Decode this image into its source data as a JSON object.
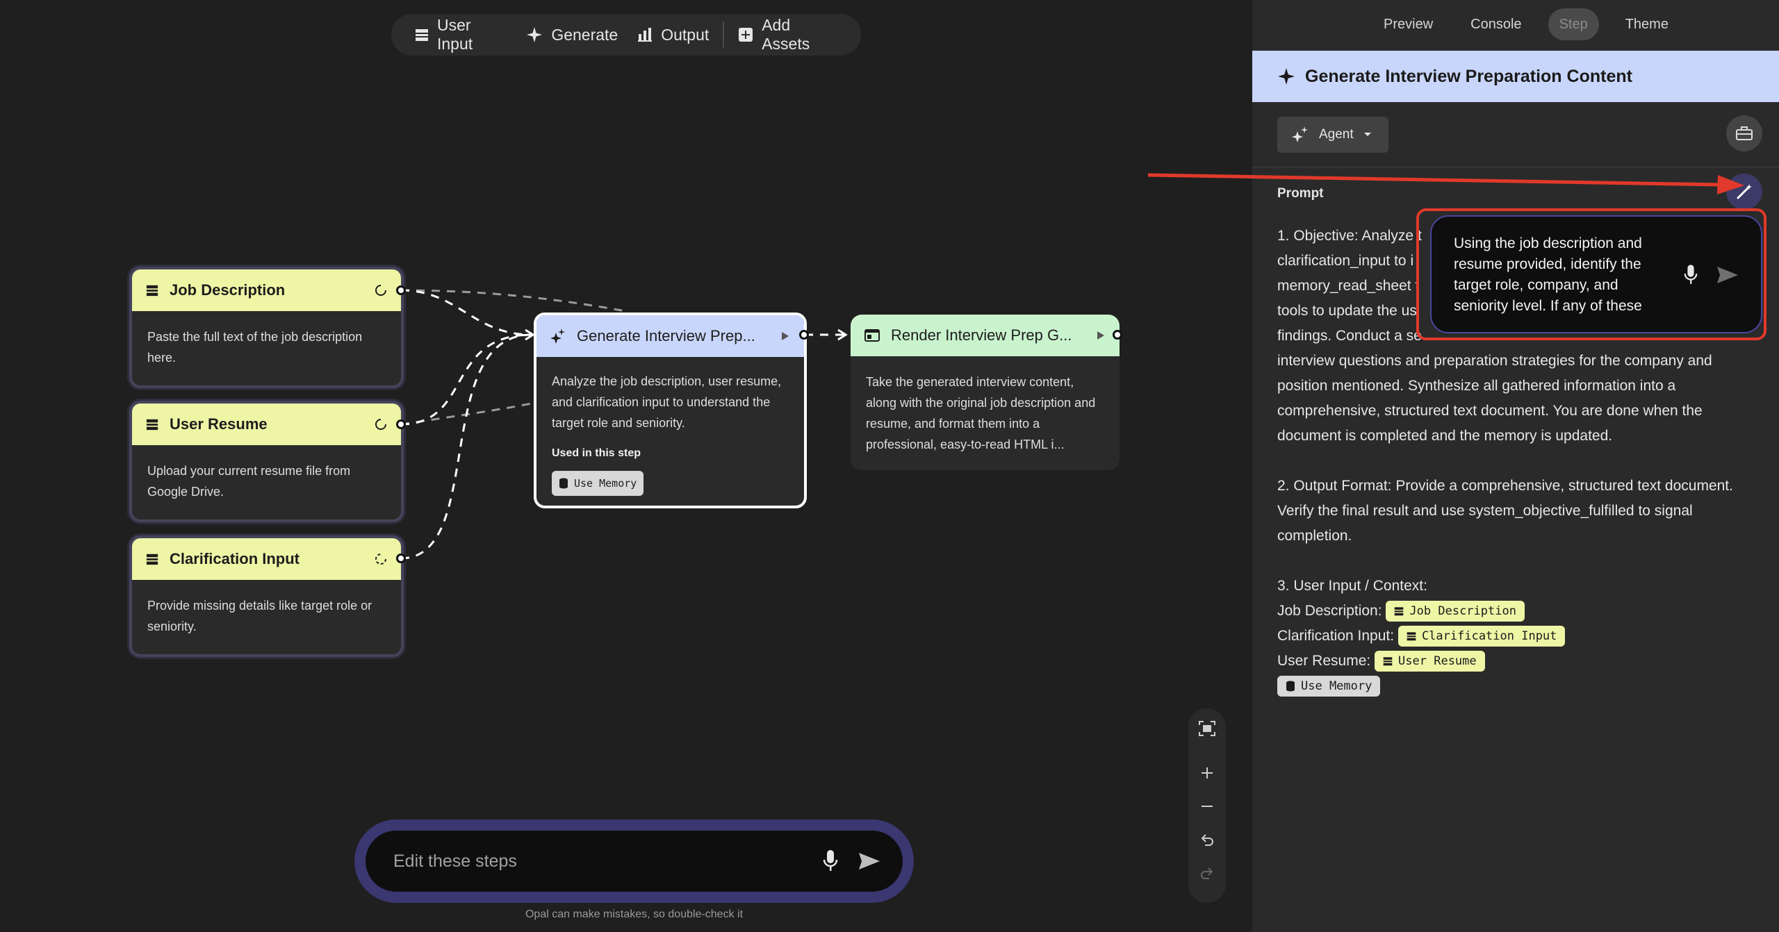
{
  "toolbar": {
    "user_input": "User Input",
    "generate": "Generate",
    "output": "Output",
    "add_assets": "Add Assets"
  },
  "nodes": {
    "job_description": {
      "title": "Job Description",
      "body": "Paste the full text of the job description here."
    },
    "user_resume": {
      "title": "User Resume",
      "body": "Upload your current resume file from Google Drive."
    },
    "clarification_input": {
      "title": "Clarification Input",
      "body": "Provide missing details like target role or seniority."
    },
    "generate": {
      "title": "Generate Interview Prep...",
      "body": "Analyze the job description, user resume, and clarification input to understand the target role and seniority.",
      "used_label": "Used in this step",
      "chip": "Use Memory"
    },
    "render": {
      "title": "Render Interview Prep G...",
      "body": "Take the generated interview content, along with the original job description and resume, and format them into a professional, easy-to-read HTML i..."
    }
  },
  "edit_bar": {
    "placeholder": "Edit these steps",
    "disclaimer": "Opal can make mistakes, so double-check it"
  },
  "panel": {
    "tabs": [
      "Preview",
      "Console",
      "Step",
      "Theme"
    ],
    "active_tab": "Step",
    "step_title": "Generate Interview Preparation Content",
    "agent_label": "Agent",
    "prompt_label": "Prompt",
    "prompt": {
      "p1_lines": [
        "1. Objective: Analyze t",
        "clarification_input to i",
        "memory_read_sheet t",
        "tools to update the us",
        "findings. Conduct a se",
        "interview questions and preparation strategies for the company and",
        "position mentioned. Synthesize all gathered information into a",
        "comprehensive, structured text document. You are done when the",
        "document is completed and the memory is updated."
      ],
      "p2": "2. Output Format: Provide a comprehensive, structured text document. Verify the final result and use system_objective_fulfilled to signal completion.",
      "p3_heading": "3. User Input / Context:",
      "job_description_label": "Job Description:",
      "job_description_chip": "Job Description",
      "clarification_label": "Clarification Input:",
      "clarification_chip": "Clarification Input",
      "resume_label": "User Resume:",
      "resume_chip": "User Resume",
      "memory_chip": "Use Memory"
    },
    "popover_text": "Using the job description and resume provided, identify the target role, company, and seniority level. If any of these"
  },
  "colors": {
    "annotation_red": "#e1392b",
    "input_node_header": "#eef6a6",
    "generate_node_header": "#c9d6fb",
    "output_node_header": "#c9f3cd"
  }
}
